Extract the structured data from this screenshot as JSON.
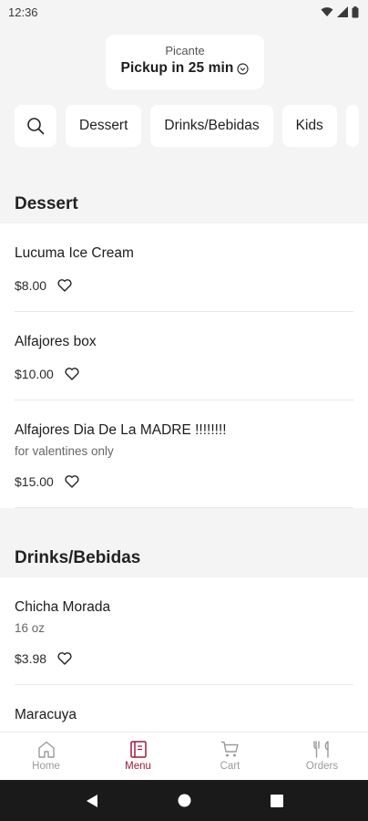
{
  "status": {
    "time": "12:36"
  },
  "header": {
    "store_name": "Picante",
    "pickup_text": "Pickup in 25 min"
  },
  "categories": [
    "Dessert",
    "Drinks/Bebidas",
    "Kids"
  ],
  "sections": [
    {
      "title": "Dessert",
      "items": [
        {
          "name": "Lucuma Ice Cream",
          "description": "",
          "price": "$8.00"
        },
        {
          "name": "Alfajores box",
          "description": "",
          "price": "$10.00"
        },
        {
          "name": "Alfajores Dia De La MADRE !!!!!!!!",
          "description": "for valentines only",
          "price": "$15.00"
        }
      ]
    },
    {
      "title": "Drinks/Bebidas",
      "items": [
        {
          "name": "Chicha Morada",
          "description": "16 oz",
          "price": "$3.98"
        },
        {
          "name": "Maracuya",
          "description": "",
          "price": ""
        }
      ]
    }
  ],
  "nav": [
    {
      "label": "Home",
      "icon": "home-icon",
      "active": false
    },
    {
      "label": "Menu",
      "icon": "menu-icon",
      "active": true
    },
    {
      "label": "Cart",
      "icon": "cart-icon",
      "active": false
    },
    {
      "label": "Orders",
      "icon": "orders-icon",
      "active": false
    }
  ],
  "colors": {
    "accent": "#9b1a3a",
    "background": "#f4f4f4",
    "card": "#ffffff"
  }
}
